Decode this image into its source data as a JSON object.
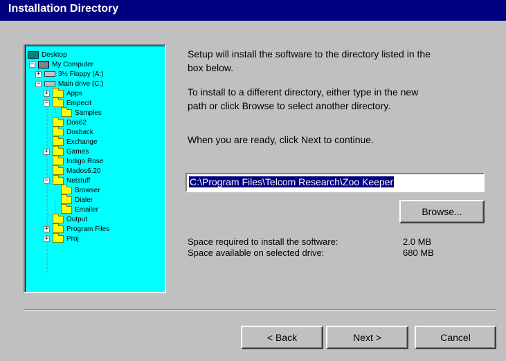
{
  "window": {
    "title": "Installation Directory"
  },
  "tree": {
    "items": [
      {
        "label": "Desktop",
        "icon": "desktop-icon"
      },
      {
        "label": "My Computer",
        "icon": "computer-icon"
      },
      {
        "label": "3½ Floppy (A:)",
        "icon": "floppy-drive-icon"
      },
      {
        "label": "Main drive (C:)",
        "icon": "hard-drive-icon"
      },
      {
        "label": "Apps",
        "icon": "folder-icon"
      },
      {
        "label": "Empecit",
        "icon": "folder-icon"
      },
      {
        "label": "Samples",
        "icon": "folder-icon"
      },
      {
        "label": "Dos62",
        "icon": "folder-icon"
      },
      {
        "label": "Dosback",
        "icon": "folder-icon"
      },
      {
        "label": "Exchange",
        "icon": "folder-icon"
      },
      {
        "label": "Games",
        "icon": "folder-icon"
      },
      {
        "label": "Indigo Rose",
        "icon": "folder-icon"
      },
      {
        "label": "Mados6.20",
        "icon": "folder-icon"
      },
      {
        "label": "Netstuff",
        "icon": "folder-icon"
      },
      {
        "label": "Browser",
        "icon": "folder-icon"
      },
      {
        "label": "Dialer",
        "icon": "folder-icon"
      },
      {
        "label": "Emailer",
        "icon": "folder-icon"
      },
      {
        "label": "Output",
        "icon": "folder-icon"
      },
      {
        "label": "Program Files",
        "icon": "folder-icon"
      },
      {
        "label": "Proj",
        "icon": "folder-icon"
      }
    ]
  },
  "instructions": {
    "line1a": "Setup will install the software to the directory listed in the",
    "line1b": "box below.",
    "line2a": "To install to a different directory, either type in the new",
    "line2b": "path or click Browse to select another directory.",
    "line3": "When you are ready, click Next to continue."
  },
  "path_input": {
    "value": "C:\\Program Files\\Telcom Research\\Zoo Keeper"
  },
  "buttons": {
    "browse": "Browse...",
    "back": "< Back",
    "next": "Next >",
    "cancel": "Cancel"
  },
  "space": {
    "required_label": "Space required to install the software:",
    "required_value": "2.0 MB",
    "available_label": "Space available on selected drive:",
    "available_value": "680 MB"
  },
  "colors": {
    "title_bar": "#000080",
    "tree_background": "#00ffff",
    "dialog_background": "#c0c0c0",
    "selection": "#000080"
  }
}
